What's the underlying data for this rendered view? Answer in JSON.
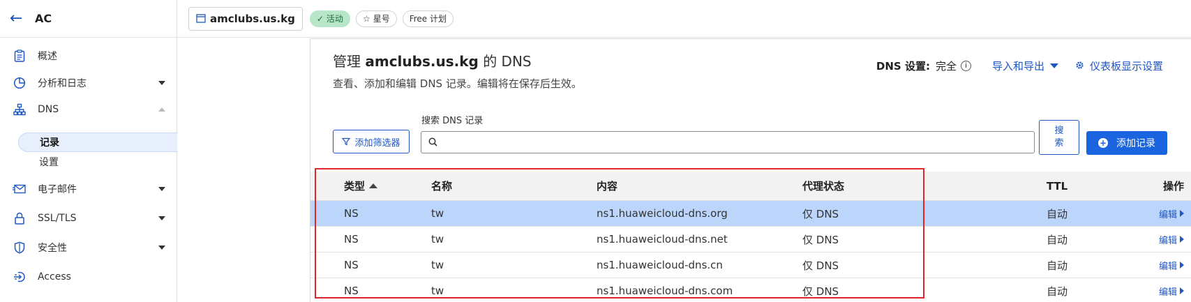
{
  "sidebar": {
    "account_name": "AC",
    "items": [
      {
        "label": "概述",
        "icon": "clipboard-icon"
      },
      {
        "label": "分析和日志",
        "icon": "chart-pie-icon"
      },
      {
        "label": "DNS",
        "icon": "network-icon"
      },
      {
        "label": "电子邮件",
        "icon": "mail-icon"
      },
      {
        "label": "SSL/TLS",
        "icon": "lock-icon"
      },
      {
        "label": "安全性",
        "icon": "shield-icon"
      },
      {
        "label": "Access",
        "icon": "access-icon"
      }
    ],
    "dns_sub": {
      "records": "记录",
      "settings": "设置"
    }
  },
  "topbar": {
    "domain": "amclubs.us.kg",
    "status_badge": "活动",
    "star_label": "星号",
    "plan_badge": "Free 计划"
  },
  "main": {
    "title_prefix": "管理",
    "title_domain": "amclubs.us.kg",
    "title_suffix": "的 DNS",
    "subtitle": "查看、添加和编辑 DNS 记录。编辑将在保存后生效。",
    "dns_setting_label": "DNS 设置:",
    "dns_setting_value": "完全",
    "import_export": "导入和导出",
    "dashboard_settings": "仪表板显示设置",
    "filter_button": "添加筛选器",
    "search_label": "搜索 DNS 记录",
    "search_value": "",
    "search_button_line1": "搜",
    "search_button_line2": "索",
    "add_record_button": "添加记录"
  },
  "table": {
    "headers": {
      "type": "类型",
      "name": "名称",
      "content": "内容",
      "proxy": "代理状态",
      "ttl": "TTL",
      "actions": "操作"
    },
    "rows": [
      {
        "type": "NS",
        "name": "tw",
        "content": "ns1.huaweicloud-dns.org",
        "proxy": "仅 DNS",
        "ttl": "自动",
        "action": "编辑"
      },
      {
        "type": "NS",
        "name": "tw",
        "content": "ns1.huaweicloud-dns.net",
        "proxy": "仅 DNS",
        "ttl": "自动",
        "action": "编辑"
      },
      {
        "type": "NS",
        "name": "tw",
        "content": "ns1.huaweicloud-dns.cn",
        "proxy": "仅 DNS",
        "ttl": "自动",
        "action": "编辑"
      },
      {
        "type": "NS",
        "name": "tw",
        "content": "ns1.huaweicloud-dns.com",
        "proxy": "仅 DNS",
        "ttl": "自动",
        "action": "编辑"
      }
    ]
  },
  "colors": {
    "accent": "#1f57c3",
    "primary_button": "#1a64e0",
    "selected_row": "#bcd5fb",
    "highlight": "#e0262b",
    "active_badge": "#b8e6c9"
  }
}
